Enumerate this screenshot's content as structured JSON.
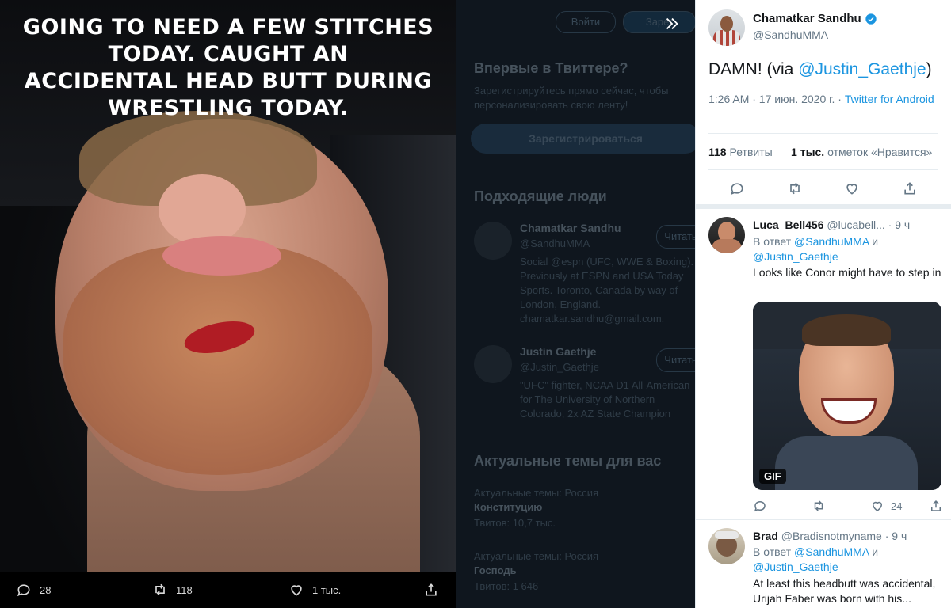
{
  "media": {
    "caption_lines": [
      "Going to need a few stitches today. Caught an",
      "accidental head butt during wrestling today."
    ],
    "actions": {
      "replies": "28",
      "retweets": "118",
      "likes": "1 тыс."
    }
  },
  "background": {
    "login": "Войти",
    "signup_small": "Зарег",
    "new_heading": "Впервые в Твиттере?",
    "new_text": "Зарегистрируйтесь прямо сейчас, чтобы персонализировать свою ленту!",
    "signup_button": "Зарегистрироваться",
    "people_heading": "Подходящие люди",
    "person1": {
      "name": "Chamatkar Sandhu",
      "handle": "@SandhuMMA",
      "follow": "Читать",
      "bio": "Social @espn (UFC, WWE & Boxing). Previously at ESPN and USA Today Sports. Toronto, Canada by way of London, England. chamatkar.sandhu@gmail.com."
    },
    "person2": {
      "name": "Justin Gaethje",
      "handle": "@Justin_Gaethje",
      "follow": "Читать",
      "bio": "\"UFC\" fighter, NCAA D1 All-American for The University of Northern Colorado, 2x AZ State Champion"
    },
    "trends_heading": "Актуальные темы для вас",
    "trend1": {
      "context": "Актуальные темы: Россия",
      "name": "Конституцию",
      "count": "Твитов: 10,7 тыс."
    },
    "trend2": {
      "context": "Актуальные темы: Россия",
      "name": "Господь",
      "count": "Твитов: 1 646"
    }
  },
  "tweet": {
    "author_name": "Chamatkar Sandhu",
    "author_handle": "@SandhuMMA",
    "text_main": "DAMN! (via ",
    "text_mention": "@Justin_Gaethje",
    "text_end": ")",
    "time": "1:26 AM · 17 июн. 2020 г. · ",
    "source": "Twitter for Android",
    "retweets_count": "118",
    "retweets_label": "Ретвиты",
    "likes_count": "1 тыс.",
    "likes_label": "отметок «Нравится»"
  },
  "replies": [
    {
      "name": "Luca_Bell456",
      "handle": "@lucabell...",
      "time": "· 9 ч",
      "reply_to_prefix": "В ответ ",
      "reply_to_1": "@SandhuMMA",
      "reply_to_and": " и",
      "reply_to_2": "@Justin_Gaethje",
      "text": "Looks like Conor might have to step in",
      "gif_label": "GIF",
      "likes": "24"
    },
    {
      "name": "Brad",
      "handle": "@Bradisnotmyname",
      "time": "· 9 ч",
      "reply_to_prefix": "В ответ ",
      "reply_to_1": "@SandhuMMA",
      "reply_to_and": " и",
      "reply_to_2": "@Justin_Gaethje",
      "text": "At least this headbutt was accidental, Urijah Faber was born with his..."
    }
  ],
  "colors": {
    "link": "#1b95e0",
    "text_dark": "#14171a",
    "text_gray": "#657786"
  }
}
